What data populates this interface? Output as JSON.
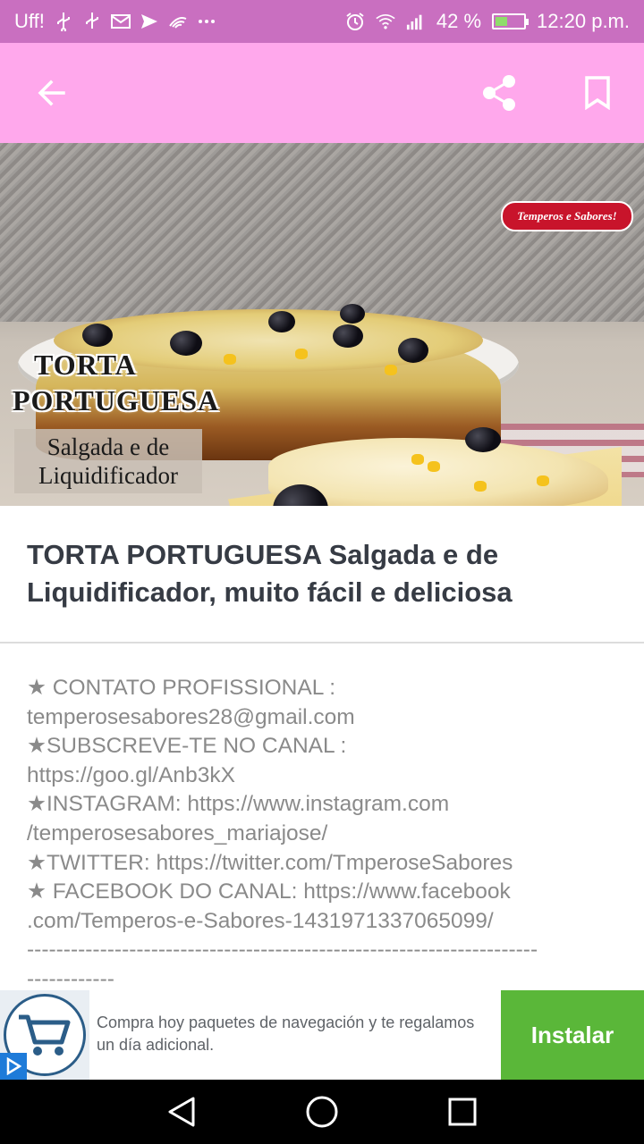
{
  "status_bar": {
    "carrier": "Uff!",
    "battery_percent": "42 %",
    "time": "12:20 p.m.",
    "battery_level": 0.42,
    "notification_icons": [
      "usb-icon",
      "usb-icon",
      "mail-icon",
      "send-icon",
      "wifi-hotspot-icon",
      "more-icon"
    ],
    "system_icons": [
      "alarm-icon",
      "wifi-icon",
      "signal-icon",
      "battery-icon"
    ]
  },
  "app_bar": {
    "background": "#ffa8ec",
    "icons": [
      "arrow-back-icon",
      "share-icon",
      "bookmark-icon"
    ]
  },
  "hero": {
    "title_line1": "TORTA",
    "title_line2": "PORTUGUESA",
    "subtitle_line1": "Salgada e de",
    "subtitle_line2": "Liquidificador",
    "watermark": "Temperos e Sabores!"
  },
  "article": {
    "title": "TORTA PORTUGUESA Salgada e de Liquidificador, muito fácil e deliciosa",
    "description_lines": [
      "★ CONTATO PROFISSIONAL :",
      "temperosesabores28@gmail.com",
      "★SUBSCREVE-TE NO CANAL :",
      "https://goo.gl/Anb3kX",
      "★INSTAGRAM: https://www.instagram.com",
      "/temperosesabores_mariajose/",
      "★TWITTER:  https://twitter.com/TmperoseSabores",
      "★ FACEBOOK DO CANAL:  https://www.facebook",
      ".com/Temperos-e-Sabores-1431971337065099/",
      "----------------------------------------------------------------------",
      "------------"
    ]
  },
  "ad": {
    "text": "Compra hoy paquetes de navegación y te regalamos un día adicional.",
    "install_label": "Instalar",
    "install_color": "#5ab739",
    "logo_icon": "shopping-cart-icon",
    "adchoices_icon": "adchoices-icon"
  },
  "nav_bar": {
    "icons": [
      "back-triangle-icon",
      "home-circle-icon",
      "recents-square-icon"
    ]
  }
}
